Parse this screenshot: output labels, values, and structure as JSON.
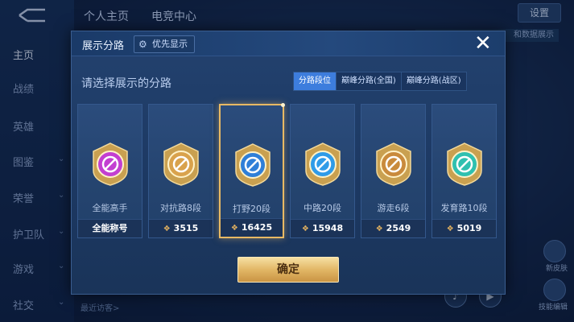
{
  "background": {
    "top_tabs": [
      "个人主页",
      "电竞中心"
    ],
    "top_right_button": "设置",
    "banner_text": "和数据展示",
    "sidebar": [
      {
        "label": "主页",
        "active": true,
        "chevron": false
      },
      {
        "label": "战绩",
        "active": false,
        "chevron": false
      },
      {
        "label": "英雄",
        "active": false,
        "chevron": false
      },
      {
        "label": "图鉴",
        "active": false,
        "chevron": true
      },
      {
        "label": "荣誉",
        "active": false,
        "chevron": true
      },
      {
        "label": "护卫队",
        "active": false,
        "chevron": true
      },
      {
        "label": "游戏",
        "active": false,
        "chevron": true
      },
      {
        "label": "社交",
        "active": false,
        "chevron": true
      }
    ],
    "visitors_label": "最近访客>",
    "right_labels": [
      "新皮肤",
      "技能编辑"
    ]
  },
  "modal": {
    "title": "展示分路",
    "priority_button": "优先显示",
    "subtitle": "请选择展示的分路",
    "tabs": [
      {
        "label": "分路段位",
        "active": true
      },
      {
        "label": "巅峰分路(全国)",
        "active": false
      },
      {
        "label": "巅峰分路(战区)",
        "active": false
      }
    ],
    "cards": [
      {
        "rank": "全能高手",
        "score": "全能称号",
        "has_points": false,
        "selected": false,
        "icon": "all-round-emblem-icon",
        "color": "#c33fd1"
      },
      {
        "rank": "对抗路8段",
        "score": "3515",
        "has_points": true,
        "selected": false,
        "icon": "clash-lane-emblem-icon",
        "color": "#d9a24c"
      },
      {
        "rank": "打野20段",
        "score": "16425",
        "has_points": true,
        "selected": true,
        "icon": "jungle-emblem-icon",
        "color": "#2f7fd8"
      },
      {
        "rank": "中路20段",
        "score": "15948",
        "has_points": true,
        "selected": false,
        "icon": "mid-lane-emblem-icon",
        "color": "#2f9be8"
      },
      {
        "rank": "游走6段",
        "score": "2549",
        "has_points": true,
        "selected": false,
        "icon": "roam-emblem-icon",
        "color": "#c98a3c"
      },
      {
        "rank": "发育路10段",
        "score": "5019",
        "has_points": true,
        "selected": false,
        "icon": "farm-lane-emblem-icon",
        "color": "#2fc0b0"
      }
    ],
    "confirm_label": "确定"
  }
}
